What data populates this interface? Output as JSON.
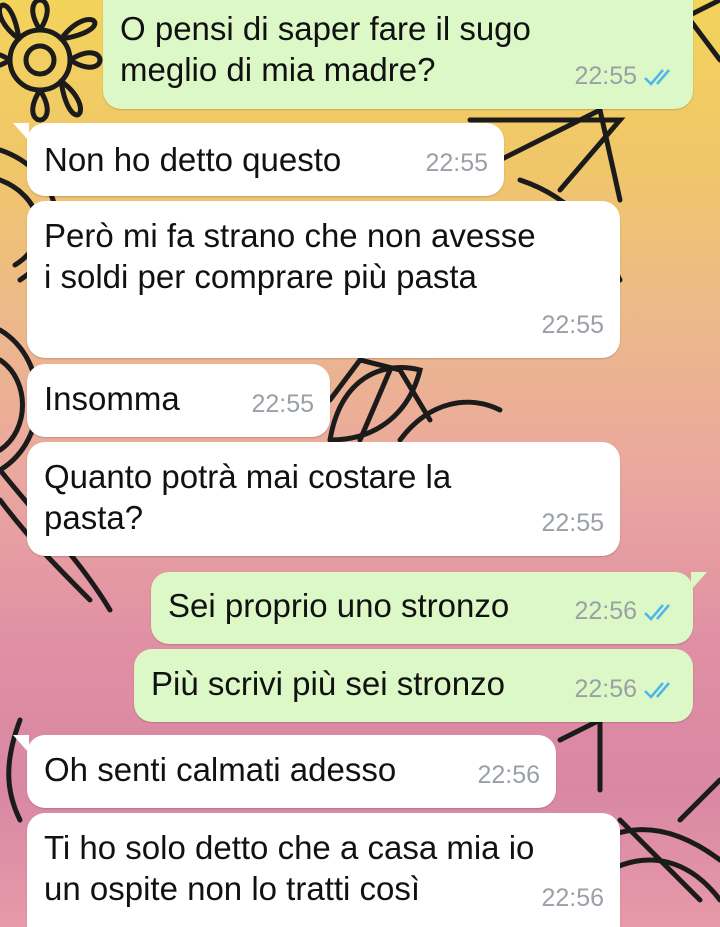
{
  "colors": {
    "incoming": "#ffffff",
    "outgoing": "#dcf8c6",
    "read_ticks": "#4fb6ec",
    "time": "#9aa0a6"
  },
  "messages": [
    {
      "dir": "out",
      "text": "O pensi di saper fare il sugo\nmeglio di mia madre?",
      "time": "22:55",
      "status": "read-ticks-icon"
    },
    {
      "dir": "in",
      "text": "Non ho detto questo",
      "time": "22:55"
    },
    {
      "dir": "in",
      "text": "Però mi fa strano che non avesse\ni soldi per comprare più pasta",
      "time": "22:55"
    },
    {
      "dir": "in",
      "text": "Insomma",
      "time": "22:55"
    },
    {
      "dir": "in",
      "text": "Quanto potrà mai costare la\npasta?",
      "time": "22:55"
    },
    {
      "dir": "out",
      "text": "Sei proprio uno stronzo",
      "time": "22:56",
      "status": "read-ticks-icon"
    },
    {
      "dir": "out",
      "text": "Più scrivi più sei stronzo",
      "time": "22:56",
      "status": "read-ticks-icon"
    },
    {
      "dir": "in",
      "text": "Oh senti calmati adesso",
      "time": "22:56"
    },
    {
      "dir": "in",
      "text": "Ti ho solo detto che a casa mia io\nun ospite non lo tratti così",
      "time": "22:56"
    }
  ]
}
